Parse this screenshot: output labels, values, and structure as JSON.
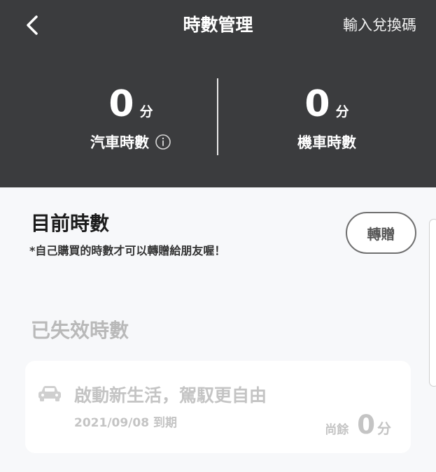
{
  "header": {
    "back_icon": "chevron-left-icon",
    "title": "時數管理",
    "redeem_label": "輸入兌換碼"
  },
  "stats": {
    "car": {
      "value": "0",
      "unit": "分",
      "label": "汽車時數",
      "info_icon": "info-icon"
    },
    "moto": {
      "value": "0",
      "unit": "分",
      "label": "機車時數"
    }
  },
  "current": {
    "title": "目前時數",
    "note": "*自己購買的時數才可以轉贈給朋友喔！",
    "transfer_label": "轉贈"
  },
  "expired": {
    "title": "已失效時數",
    "items": [
      {
        "icon": "car-icon",
        "name": "啟動新生活，駕馭更自由",
        "expiry": "2021/09/08 到期",
        "remain_prefix": "尚餘",
        "remain_value": "0",
        "remain_unit": "分"
      }
    ]
  },
  "colors": {
    "header_bg": "#3b3c3e",
    "page_bg": "#f7f8fa",
    "muted_text": "#c4c4c4"
  }
}
